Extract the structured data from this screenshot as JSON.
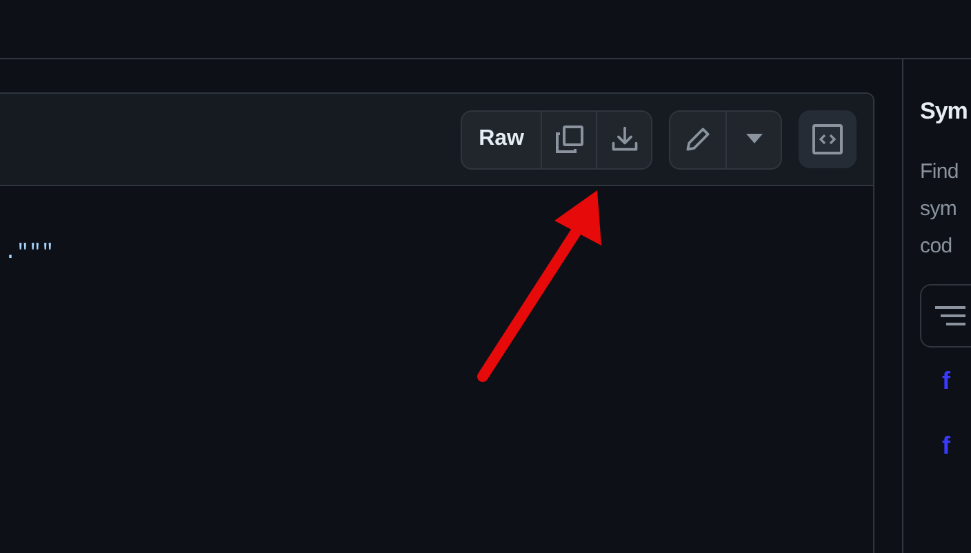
{
  "file_toolbar": {
    "buttons": [
      {
        "kind": "raw",
        "label": "Raw"
      },
      {
        "kind": "copy"
      },
      {
        "kind": "download"
      }
    ],
    "edit_buttons": [
      {
        "kind": "edit"
      },
      {
        "kind": "menu"
      }
    ],
    "symbols_button": {
      "selected": true
    }
  },
  "code_lines": [
    ".\"\"\""
  ],
  "symbols_panel": {
    "title": "Sym",
    "description": [
      "Find",
      "sym",
      "cod"
    ],
    "items": [
      "f",
      "f"
    ]
  },
  "annotation": {
    "kind": "arrow",
    "color": "#e60a0a"
  }
}
